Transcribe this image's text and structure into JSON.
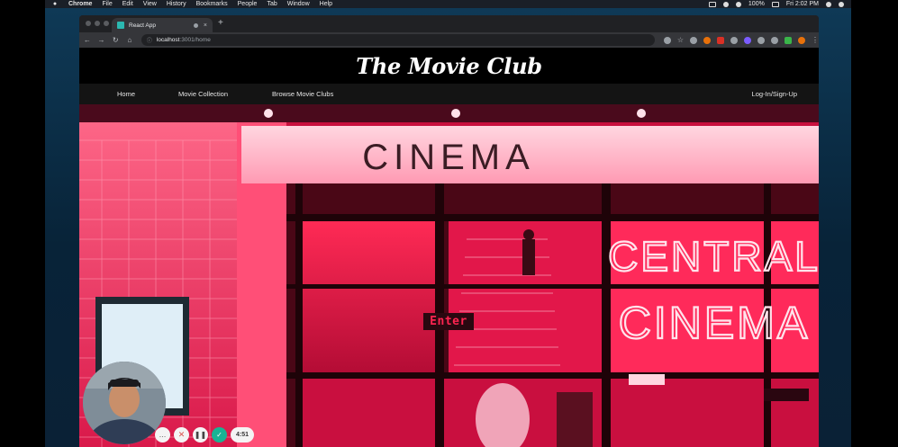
{
  "menubar": {
    "app": "Chrome",
    "items": [
      "File",
      "Edit",
      "View",
      "History",
      "Bookmarks",
      "People",
      "Tab",
      "Window",
      "Help"
    ],
    "battery": "100%",
    "clock": "Fri 2:02 PM"
  },
  "browser": {
    "tab_title": "React App",
    "new_tab_symbol": "+",
    "tab_close_symbol": "×",
    "url_host": "localhost",
    "url_path": ":3001/home",
    "back": "←",
    "forward": "→",
    "reload": "↻",
    "home": "⌂",
    "info": "ⓘ",
    "star": "☆"
  },
  "site": {
    "title": "The Movie Club",
    "nav": {
      "home": "Home",
      "collection": "Movie Collection",
      "browse": "Browse Movie Clubs",
      "login": "Log-In/Sign-Up"
    },
    "hero": {
      "marquee": "CINEMA",
      "neon_line1": "CENTRAL",
      "neon_line2": "CINEMA",
      "enter_label": "Enter"
    }
  },
  "recorder": {
    "more": "…",
    "cancel": "✕",
    "pause": "❚❚",
    "done": "✓",
    "time": "4:51"
  },
  "colors": {
    "neon": "#ff2d55",
    "hero_pink": "#ff3b6a",
    "header_bg": "#000000",
    "nav_bg": "#141414"
  }
}
